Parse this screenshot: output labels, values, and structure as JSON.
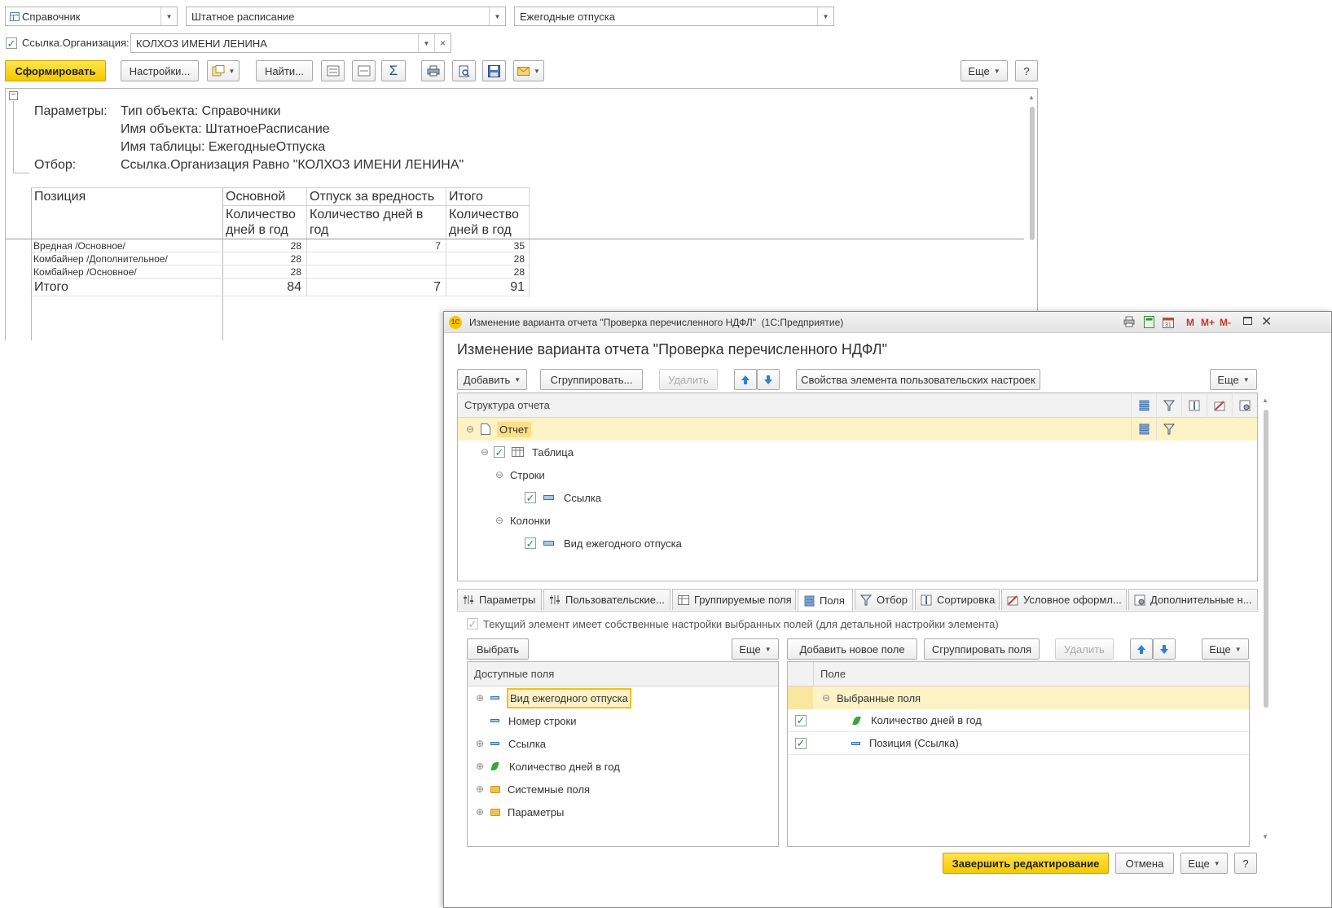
{
  "top_form": {
    "object_type": "Справочник",
    "object_name": "Штатное расписание",
    "table_name": "Ежегодные отпуска",
    "filter_label": "Ссылка.Организация:",
    "filter_value": "КОЛХОЗ ИМЕНИ ЛЕНИНА",
    "filter_checked": true
  },
  "toolbar": {
    "generate": "Сформировать",
    "settings": "Настройки...",
    "find": "Найти...",
    "sum_symbol": "Σ",
    "more": "Еще",
    "help": "?"
  },
  "report": {
    "params_label": "Параметры:",
    "param_lines": [
      "Тип объекта: Справочники",
      "Имя объекта: ШтатноеРасписание",
      "Имя таблицы: ЕжегодныеОтпуска"
    ],
    "filter_label": "Отбор:",
    "filter_text": "Ссылка.Организация Равно \"КОЛХОЗ ИМЕНИ ЛЕНИНА\"",
    "headers": {
      "position": "Позиция",
      "col1": "Основной",
      "col2": "Отпуск за вредность",
      "col3": "Итого",
      "col1_sub": [
        "Количество",
        "дней в год"
      ],
      "col2_sub": [
        "Количество дней в",
        "год"
      ],
      "col3_sub": [
        "Количество",
        "дней в год"
      ]
    },
    "rows": [
      {
        "name": "Вредная /Основное/",
        "c1": "28",
        "c2": "7",
        "c3": "35"
      },
      {
        "name": "Комбайнер /Дополнительное/",
        "c1": "28",
        "c2": "",
        "c3": "28"
      },
      {
        "name": "Комбайнер /Основное/",
        "c1": "28",
        "c2": "",
        "c3": "28"
      }
    ],
    "total": {
      "name": "Итого",
      "c1": "84",
      "c2": "7",
      "c3": "91"
    }
  },
  "dialog": {
    "window_title": "Изменение варианта отчета \"Проверка перечисленного НДФЛ\"  (1С:Предприятие)",
    "title_buttons": [
      "M",
      "M+",
      "M-"
    ],
    "heading": "Изменение варианта отчета \"Проверка перечисленного НДФЛ\"",
    "toolbar": {
      "add": "Добавить",
      "group": "Сгруппировать...",
      "delete": "Удалить",
      "props": "Свойства элемента пользовательских настроек",
      "more": "Еще"
    },
    "structure": {
      "header": "Структура отчета",
      "items": [
        {
          "label": "Отчет",
          "level": 0
        },
        {
          "label": "Таблица",
          "level": 1
        },
        {
          "label": "Строки",
          "level": 2
        },
        {
          "label": "Ссылка",
          "level": 3
        },
        {
          "label": "Колонки",
          "level": 2
        },
        {
          "label": "Вид ежегодного отпуска",
          "level": 3
        }
      ]
    },
    "tabs": [
      "Параметры",
      "Пользовательские...",
      "Группируемые поля",
      "Поля",
      "Отбор",
      "Сортировка",
      "Условное оформл...",
      "Дополнительные н..."
    ],
    "active_tab": "Поля",
    "own_settings_label": "Текущий элемент имеет собственные настройки выбранных полей (для детальной настройки элемента)",
    "left": {
      "select": "Выбрать",
      "more": "Еще",
      "header": "Доступные поля",
      "items": [
        "Вид ежегодного отпуска",
        "Номер строки",
        "Ссылка",
        "Количество дней в год",
        "Системные поля",
        "Параметры"
      ]
    },
    "right": {
      "add_field": "Добавить новое поле",
      "group_fields": "Сгруппировать поля",
      "delete": "Удалить",
      "more": "Еще",
      "header": "Поле",
      "group_label": "Выбранные поля",
      "items": [
        "Количество дней в год",
        "Позиция (Ссылка)"
      ]
    },
    "footer": {
      "finish": "Завершить редактирование",
      "cancel": "Отмена",
      "more": "Еще",
      "help": "?"
    }
  },
  "colors": {
    "primary_button": "#f5c800",
    "selection": "#fdf1c6",
    "check": "#1a9a3a",
    "arrow": "#2f7fd8"
  }
}
